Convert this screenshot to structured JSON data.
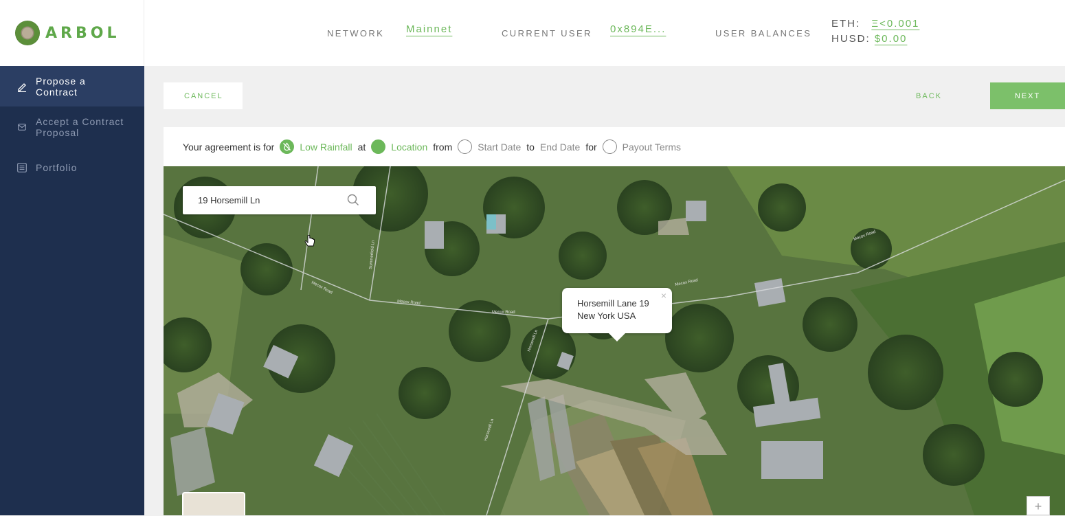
{
  "brand": {
    "name": "ARBOL",
    "accent": "#6cb85a",
    "sidebar_bg": "#1e2f4e"
  },
  "header": {
    "network_label": "NETWORK",
    "network_value": "Mainnet",
    "user_label": "CURRENT USER",
    "user_value": "0x894E...",
    "balances_label": "USER BALANCES",
    "eth_label": "ETH:",
    "eth_value": "Ξ<0.001",
    "husd_label": "HUSD:",
    "husd_value": "$0.00"
  },
  "sidebar": {
    "items": [
      {
        "label": "Propose a\nContract",
        "icon": "pencil-icon",
        "active": true
      },
      {
        "label": "Accept a Contract\nProposal",
        "icon": "envelope-icon",
        "active": false
      },
      {
        "label": "Portfolio",
        "icon": "list-icon",
        "active": false
      }
    ]
  },
  "toolbar": {
    "cancel_label": "CANCEL",
    "back_label": "BACK",
    "next_label": "NEXT"
  },
  "agreement": {
    "prefix": "Your agreement is for",
    "risk": "Low Rainfall",
    "at": "at",
    "location": "Location",
    "from": "from",
    "start": "Start Date",
    "to": "to",
    "end": "End Date",
    "for": "for",
    "payout": "Payout Terms"
  },
  "map": {
    "search_value": "19 Horsemill Ln",
    "popup_line1": "Horsemill Lane 19",
    "popup_line2": "New York USA",
    "popup_close": "×",
    "zoom_in": "+",
    "road_labels": [
      "Mecox Road",
      "Mecox Road",
      "Mecox Road",
      "Mecox Road",
      "Mecox Road",
      "Horsemill Ln",
      "Horsemill Ln",
      "Summerfield Ln"
    ]
  }
}
